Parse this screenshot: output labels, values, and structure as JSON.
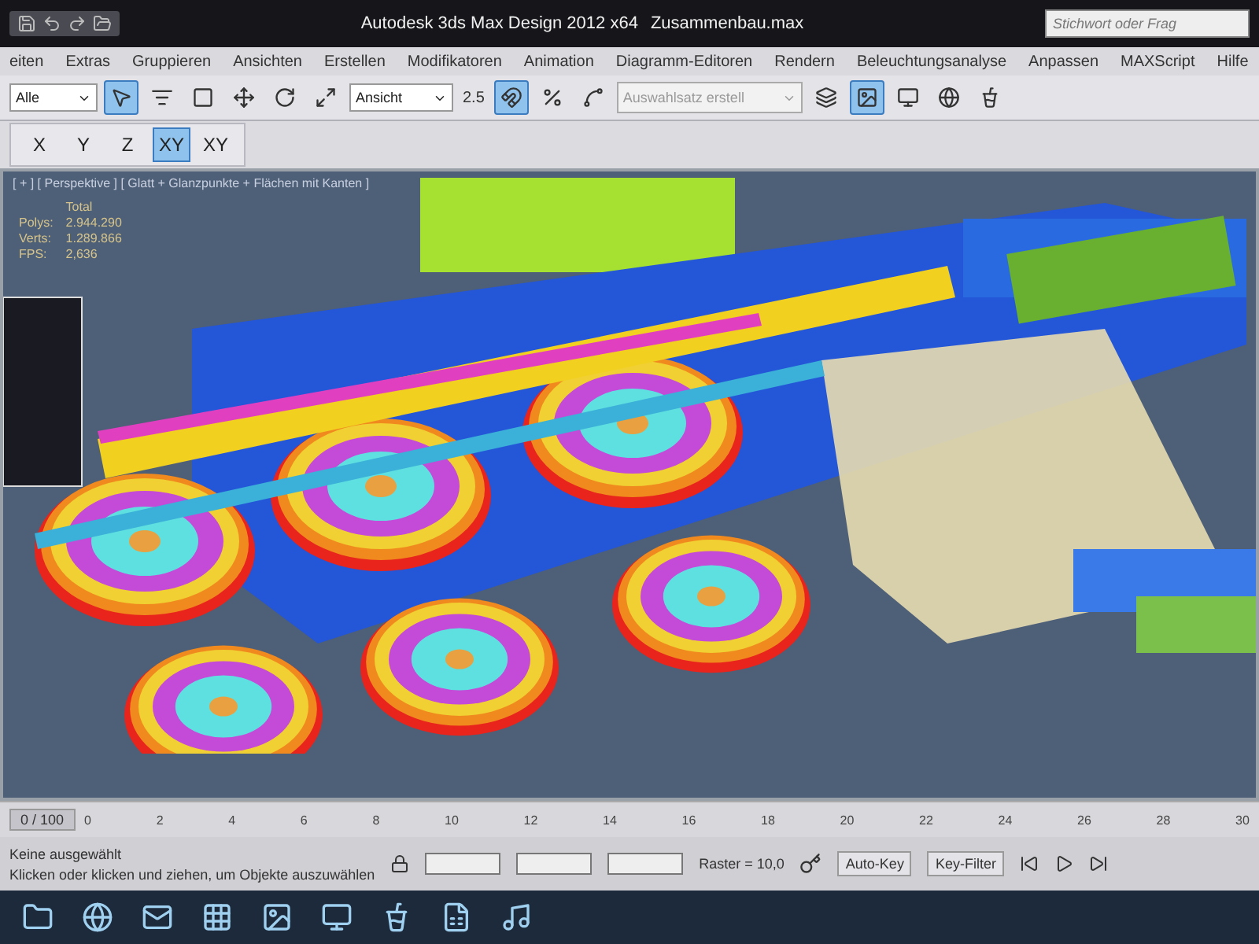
{
  "window": {
    "title": "Autodesk 3ds Max Design 2012 x64",
    "file": "Zusammenbau.max"
  },
  "search": {
    "placeholder": "Stichwort oder Frag"
  },
  "menu": [
    "eiten",
    "Extras",
    "Gruppieren",
    "Ansichten",
    "Erstellen",
    "Modifikatoren",
    "Animation",
    "Diagramm-Editoren",
    "Rendern",
    "Beleuchtungsanalyse",
    "Anpassen",
    "MAXScript",
    "Hilfe"
  ],
  "toolbar": {
    "selection_filter": "Alle",
    "reference_coord": "Ansicht",
    "snap_label": "2.5",
    "named_selection": {
      "placeholder": "Auswahlsatz erstell"
    },
    "tools": [
      {
        "selected": true
      },
      {
        "selected": false
      },
      {
        "selected": false
      },
      {
        "selected": false
      },
      {
        "selected": false
      },
      {
        "selected": false
      },
      {
        "selected": true
      },
      {
        "selected": false
      },
      {
        "selected": false
      },
      {
        "selected": false
      },
      {
        "selected": true
      },
      {
        "selected": false
      },
      {
        "selected": false
      }
    ]
  },
  "axis_buttons": [
    {
      "label": "X",
      "selected": false
    },
    {
      "label": "Y",
      "selected": false
    },
    {
      "label": "Z",
      "selected": false
    },
    {
      "label": "XY",
      "selected": true
    },
    {
      "label": "XY",
      "selected": false
    }
  ],
  "viewport": {
    "label": "[ + ] [ Perspektive ] [ Glatt + Glanzpunkte + Flächen mit Kanten ]",
    "stats_title": "Total",
    "stats": [
      {
        "name": "Polys:",
        "value": "2.944.290"
      },
      {
        "name": "Verts:",
        "value": "1.289.866"
      },
      {
        "name": "FPS:",
        "value": "2,636"
      }
    ]
  },
  "timeline": {
    "frame": "0 / 100",
    "ticks": [
      "0",
      "2",
      "4",
      "6",
      "8",
      "10",
      "12",
      "14",
      "16",
      "18",
      "20",
      "22",
      "24",
      "26",
      "28",
      "30"
    ]
  },
  "status": {
    "selection": "Keine ausgewählt",
    "prompt": "Klicken oder klicken und ziehen, um Objekte auszuwählen",
    "grid": "Raster = 10,0",
    "autokey": "Auto-Key",
    "keyfilter": "Key-Filter"
  }
}
